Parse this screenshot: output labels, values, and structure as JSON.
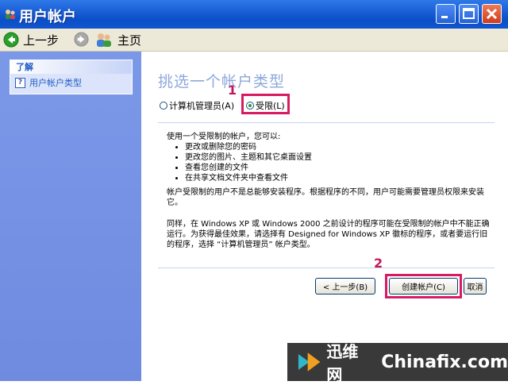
{
  "window": {
    "title": "用户帐户"
  },
  "toolbar": {
    "back_label": "上一步",
    "home_label": "主页"
  },
  "sidebar": {
    "section_title": "了解",
    "items": [
      {
        "label": "用户帐户类型"
      }
    ]
  },
  "main": {
    "heading": "挑选一个帐户类型",
    "options": [
      {
        "label": "计算机管理员(A)",
        "selected": false
      },
      {
        "label": "受限(L)",
        "selected": true
      }
    ],
    "intro": "使用一个受限制的帐户，您可以:",
    "bullets": [
      "更改或删除您的密码",
      "更改您的图片、主题和其它桌面设置",
      "查看您创建的文件",
      "在共享文档文件夹中查看文件"
    ],
    "para1": "帐户受限制的用户不是总能够安装程序。根据程序的不同，用户可能需要管理员权限来安装它。",
    "para2": "同样，在 Windows XP 或 Windows 2000 之前设计的程序可能在受限制的帐户中不能正确运行。为获得最佳效果，请选择有 Designed for Windows XP 徽标的程序，或者要运行旧的程序，选择 “计算机管理员” 帐户类型。"
  },
  "buttons": {
    "back": "< 上一步(B)",
    "create": "创建帐户(C)",
    "cancel": "取消"
  },
  "annotations": {
    "step1": "1",
    "step2": "2"
  },
  "watermark": {
    "brand": "迅维网",
    "site": "Chinafix.com"
  },
  "colors": {
    "titlebar": "#0b4fc8",
    "sidebar": "#7b98e8",
    "highlight": "#d81b60"
  }
}
